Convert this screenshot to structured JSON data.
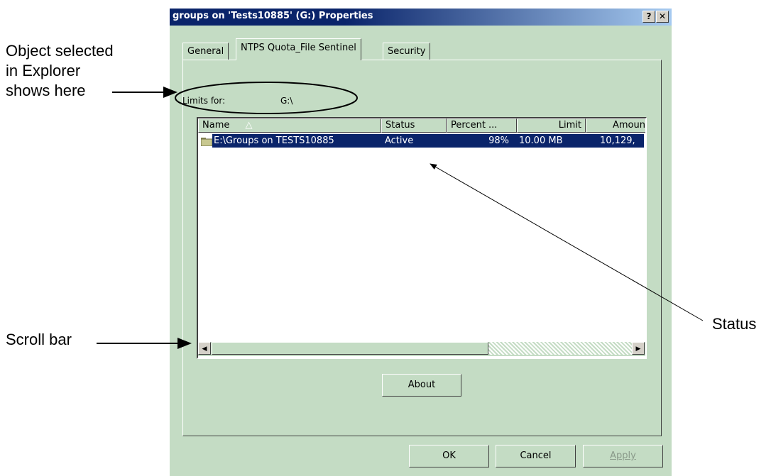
{
  "annotations": {
    "object_selected": [
      "Object selected",
      "in Explorer",
      "shows here"
    ],
    "scroll_bar": "Scroll bar",
    "status": "Status"
  },
  "window": {
    "title": "groups on 'Tests10885' (G:) Properties",
    "help_button": "?",
    "close_button": "✕"
  },
  "tabs": [
    {
      "label": "General",
      "active": false
    },
    {
      "label": "NTPS Quota_File Sentinel",
      "active": true
    },
    {
      "label": "Security",
      "active": false
    }
  ],
  "limits": {
    "label": "Limits for:",
    "value": "G:\\"
  },
  "list": {
    "columns": [
      "Name",
      "Status",
      "Percent ...",
      "Limit",
      "Amoun"
    ],
    "sort_indicator": "△",
    "rows": [
      {
        "name": "E:\\Groups on TESTS10885",
        "status": "Active",
        "percent": "98%",
        "limit": "10.00 MB",
        "amount": "10,129,",
        "selected": true
      }
    ]
  },
  "scrollbar": {
    "left_arrow": "◀",
    "right_arrow": "▶"
  },
  "buttons": {
    "about": "About",
    "ok": "OK",
    "cancel": "Cancel",
    "apply": "Apply"
  },
  "colors": {
    "dialog_bg": "#c4dcc4",
    "title_bg": "#0a246a",
    "selection": "#0a246a",
    "list_bg": "#ffffff"
  }
}
